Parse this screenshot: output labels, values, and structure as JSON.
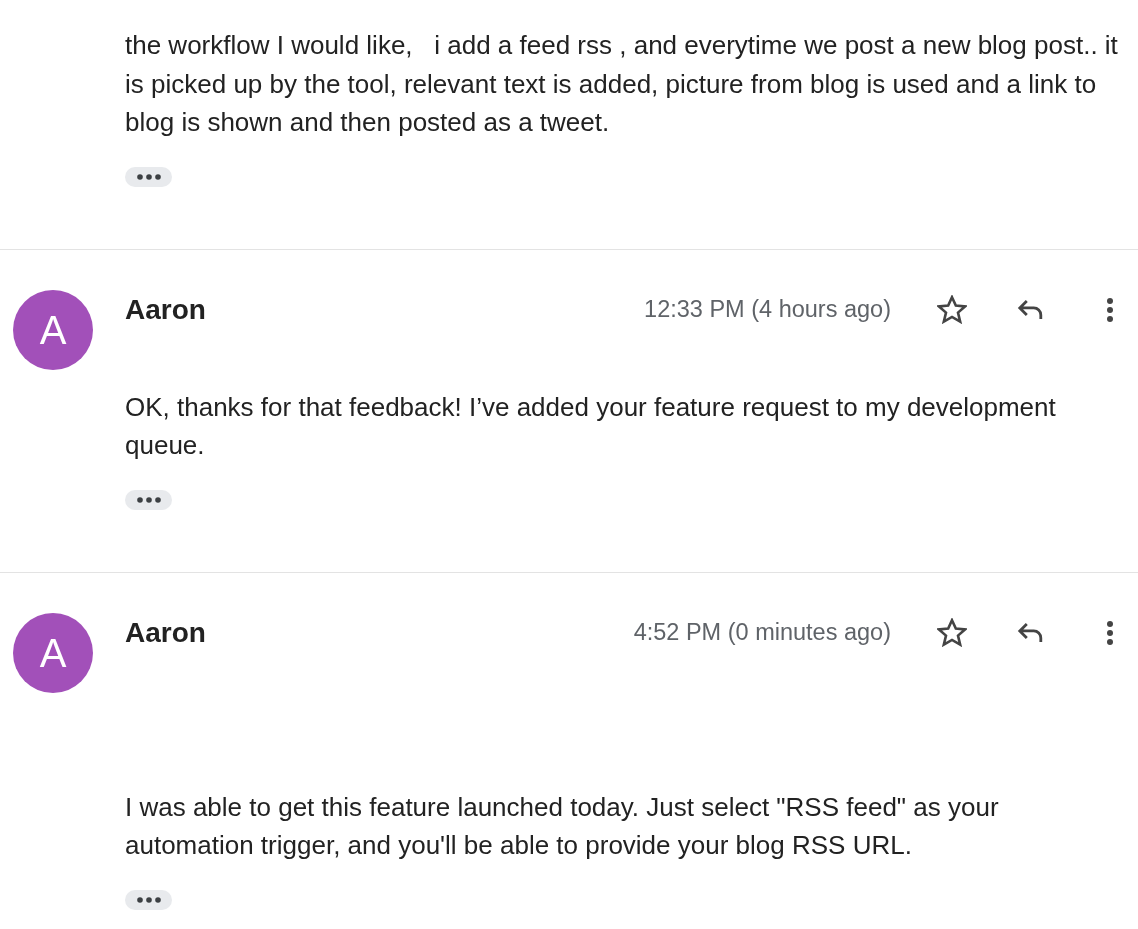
{
  "messages": [
    {
      "body": "the workflow I would like,   i add a feed rss , and everytime we post a new blog post.. it is picked up by the tool, relevant text is added, picture from blog is used and a link to blog is shown and then posted as a tweet."
    },
    {
      "sender": "Aaron",
      "avatar_letter": "A",
      "time": "12:33 PM (4 hours ago)",
      "starred": false,
      "body": "OK, thanks for that feedback! I’ve added your feature request to my development queue."
    },
    {
      "sender": "Aaron",
      "avatar_letter": "A",
      "time": "4:52 PM (0 minutes ago)",
      "starred": false,
      "body": "I was able to get this feature launched today. Just select \"RSS feed\" as your automation trigger, and you'll be able to provide your blog RSS URL."
    }
  ]
}
